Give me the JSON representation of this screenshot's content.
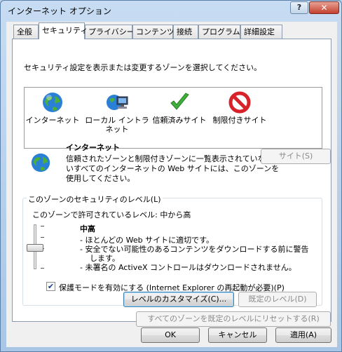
{
  "window": {
    "title": "インターネット オプション",
    "help_glyph": "?",
    "close_glyph": "✕"
  },
  "tabs": [
    {
      "label": "全般"
    },
    {
      "label": "セキュリティ"
    },
    {
      "label": "プライバシー"
    },
    {
      "label": "コンテンツ"
    },
    {
      "label": "接続"
    },
    {
      "label": "プログラム"
    },
    {
      "label": "詳細設定"
    }
  ],
  "security": {
    "select_zone_prompt": "セキュリティ設定を表示または変更するゾーンを選択してください。",
    "zones": [
      {
        "label": "インターネット",
        "icon": "globe-icon"
      },
      {
        "label": "ローカル イントラネット",
        "icon": "intranet-icon"
      },
      {
        "label": "信頼済みサイト",
        "icon": "checkmark-icon"
      },
      {
        "label": "制限付きサイト",
        "icon": "restricted-icon"
      }
    ],
    "zone_info": {
      "title": "インターネット",
      "line1": "信頼されたゾーンと制限付きゾーンに一覧表示されていな",
      "line2": "いすべてのインターネットの Web サイトには、このゾーンを",
      "line3": "使用してください。"
    },
    "sites_button": "サイト(S)",
    "level_group_title": "このゾーンのセキュリティのレベル(L)",
    "allowed_levels": "このゾーンで許可されているレベル: 中から高",
    "level_name": "中高",
    "level_description": [
      "- ほとんどの Web サイトに適切です。",
      "- 安全でない可能性のあるコンテンツをダウンロードする前に警告します。",
      "- 未署名の ActiveX コントロールはダウンロードされません。"
    ],
    "protected_mode_label": "保護モードを有効にする (Internet Explorer の再起動が必要)(P)",
    "protected_mode_checked": true,
    "check_glyph": "✔",
    "custom_level_button": "レベルのカスタマイズ(C)...",
    "default_level_button": "既定のレベル(D)",
    "reset_all_button": "すべてのゾーンを既定のレベルにリセットする(R)"
  },
  "footer": {
    "ok": "OK",
    "cancel": "キャンセル",
    "apply": "適用(A)"
  }
}
